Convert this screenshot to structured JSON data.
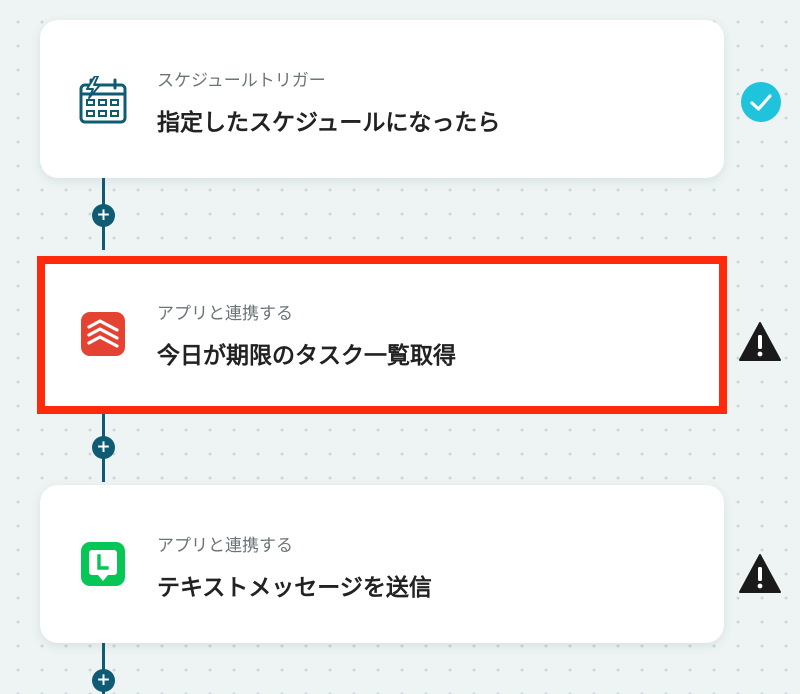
{
  "steps": [
    {
      "subtitle": "スケジュールトリガー",
      "title": "指定したスケジュールになったら",
      "app_icon": "calendar-bolt-icon",
      "status": "complete",
      "status_icon": "check-circle-icon",
      "status_color": "#1fc3db"
    },
    {
      "subtitle": "アプリと連携する",
      "title": "今日が期限のタスク一覧取得",
      "app_icon": "todoist-icon",
      "app_color": "#e44332",
      "status": "warning",
      "status_icon": "warning-icon",
      "selected": true,
      "highlight_color": "#ff2a0c"
    },
    {
      "subtitle": "アプリと連携する",
      "title": "テキストメッセージを送信",
      "app_icon": "line-icon",
      "app_color": "#06c755",
      "status": "warning",
      "status_icon": "warning-icon"
    }
  ],
  "add_button_label": "+",
  "connector_color": "#0f5b74"
}
